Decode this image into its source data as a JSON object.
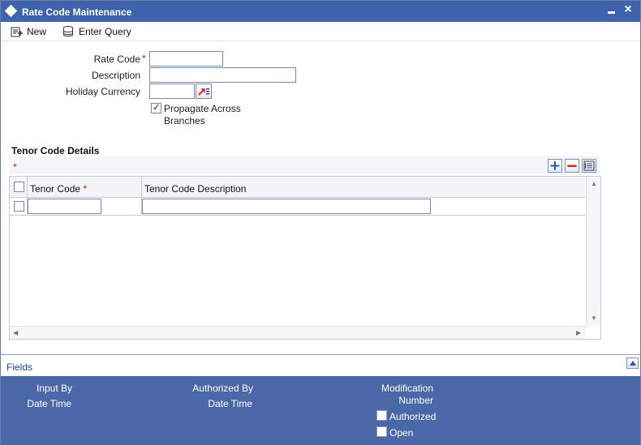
{
  "window": {
    "title": "Rate Code Maintenance",
    "minimize": "-",
    "close": "X"
  },
  "toolbar": {
    "new_label": "New",
    "enter_query_label": "Enter Query"
  },
  "form": {
    "rate_code_label": "Rate Code",
    "required_mark": "*",
    "rate_code_value": "",
    "description_label": "Description",
    "description_value": "",
    "holiday_currency_label": "Holiday Currency",
    "holiday_currency_value": "",
    "propagate_label_line1": "Propagate Across",
    "propagate_label_line2": "Branches",
    "propagate_checked": true
  },
  "tenor": {
    "section_title": "Tenor Code Details",
    "required_mark": "*",
    "columns": [
      "Tenor Code",
      "Tenor Code Description"
    ],
    "rows": [
      {
        "tenor_code": "",
        "tenor_code_description": ""
      }
    ]
  },
  "footer": {
    "fields_label": "Fields",
    "input_by_label": "Input By",
    "date_time_label": "Date Time",
    "authorized_by_label": "Authorized By",
    "date_time_label_2": "Date Time",
    "modification_label_line1": "Modification",
    "modification_label_line2": "Number",
    "authorized_label": "Authorized",
    "open_label": "Open"
  }
}
